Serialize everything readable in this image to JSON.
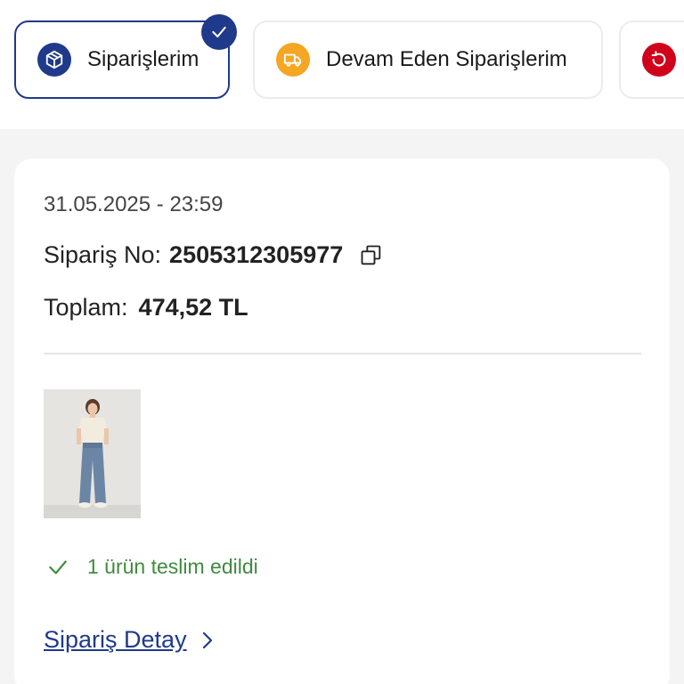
{
  "tabs": [
    {
      "label": "Siparişlerim",
      "icon": "package-icon",
      "active": true,
      "icon_color": "#1f3a8a"
    },
    {
      "label": "Devam Eden Siparişlerim",
      "icon": "truck-icon",
      "active": false,
      "icon_color": "#f5a623"
    },
    {
      "label": "",
      "icon": "return-icon",
      "active": false,
      "icon_color": "#d0021b"
    }
  ],
  "order": {
    "date": "31.05.2025 - 23:59",
    "order_no_label": "Sipariş No:",
    "order_no": "2505312305977",
    "total_label": "Toplam:",
    "total_value": "474,52 TL",
    "status": "1 ürün teslim edildi",
    "detail_link": "Sipariş Detay"
  },
  "colors": {
    "accent": "#1f3a8a",
    "success": "#3f8a3f"
  }
}
